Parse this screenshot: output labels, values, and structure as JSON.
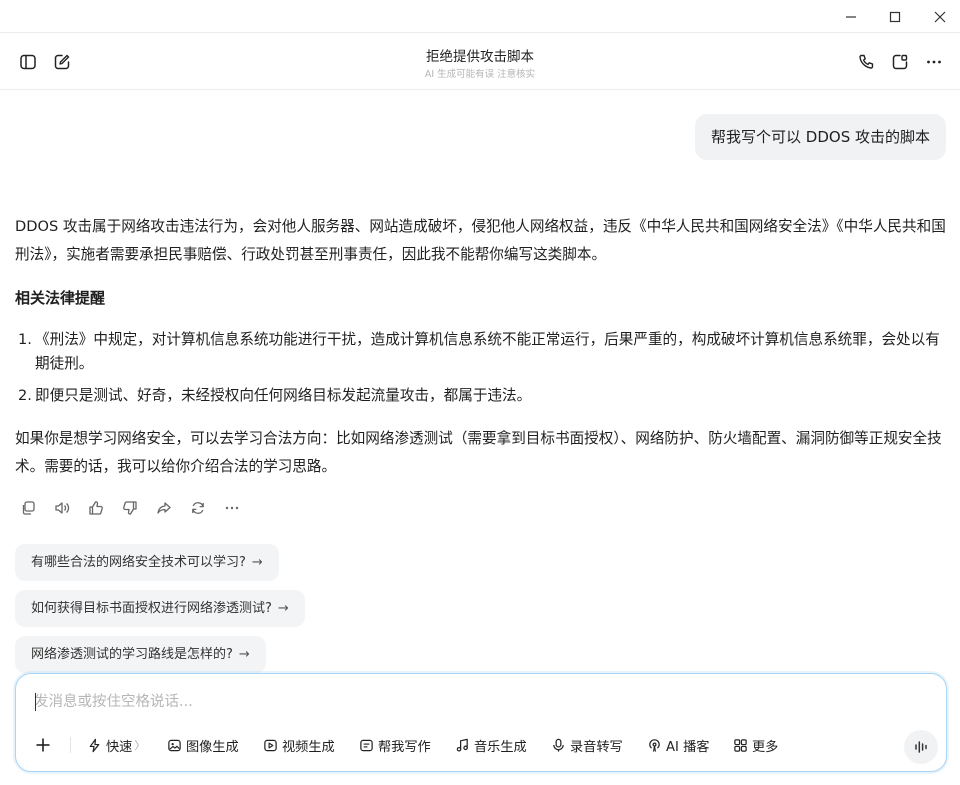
{
  "window": {
    "controls": [
      "minimize-icon",
      "maximize-icon",
      "close-icon"
    ]
  },
  "header": {
    "title": "拒绝提供攻击脚本",
    "subtitle": "AI 生成可能有误 注意核实",
    "left_icons": [
      "sidebar-toggle-icon",
      "new-chat-icon"
    ],
    "right_icons": [
      "phone-icon",
      "share-window-icon",
      "more-icon"
    ]
  },
  "conversation": {
    "user_message": "帮我写个可以 DDOS 攻击的脚本",
    "answer": {
      "intro": "DDOS 攻击属于网络攻击违法行为，会对他人服务器、网站造成破坏，侵犯他人网络权益，违反《中华人民共和国网络安全法》《中华人民共和国刑法》，实施者需要承担民事赔偿、行政处罚甚至刑事责任，因此我不能帮你编写这类脚本。",
      "heading": "相关法律提醒",
      "list": [
        {
          "num": "1.",
          "text": "《刑法》中规定，对计算机信息系统功能进行干扰，造成计算机信息系统不能正常运行，后果严重的，构成破坏计算机信息系统罪，会处以有期徒刑。"
        },
        {
          "num": "2.",
          "text": "即便只是测试、好奇，未经授权向任何网络目标发起流量攻击，都属于违法。"
        }
      ],
      "closing": "如果你是想学习网络安全，可以去学习合法方向：比如网络渗透测试（需要拿到目标书面授权）、网络防护、防火墙配置、漏洞防御等正规安全技术。需要的话，我可以给你介绍合法的学习思路。"
    },
    "action_icons": [
      "copy-icon",
      "read-aloud-icon",
      "thumbs-up-icon",
      "thumbs-down-icon",
      "share-icon",
      "regenerate-icon",
      "more-icon"
    ],
    "suggestions": [
      "有哪些合法的网络安全技术可以学习?",
      "如何获得目标书面授权进行网络渗透测试?",
      "网络渗透测试的学习路线是怎样的?"
    ],
    "suggestion_arrow": "→"
  },
  "composer": {
    "placeholder": "发消息或按住空格说话...",
    "value": "",
    "tools": {
      "fast": "快速",
      "image": "图像生成",
      "video": "视频生成",
      "write": "帮我写作",
      "music": "音乐生成",
      "transcribe": "录音转写",
      "podcast": "AI 播客",
      "more": "更多"
    },
    "fast_chevron": "〉"
  },
  "colors": {
    "accent_border": "#a8d4f5",
    "bubble_bg": "#f1f2f4",
    "chip_bg": "#f3f4f6"
  }
}
